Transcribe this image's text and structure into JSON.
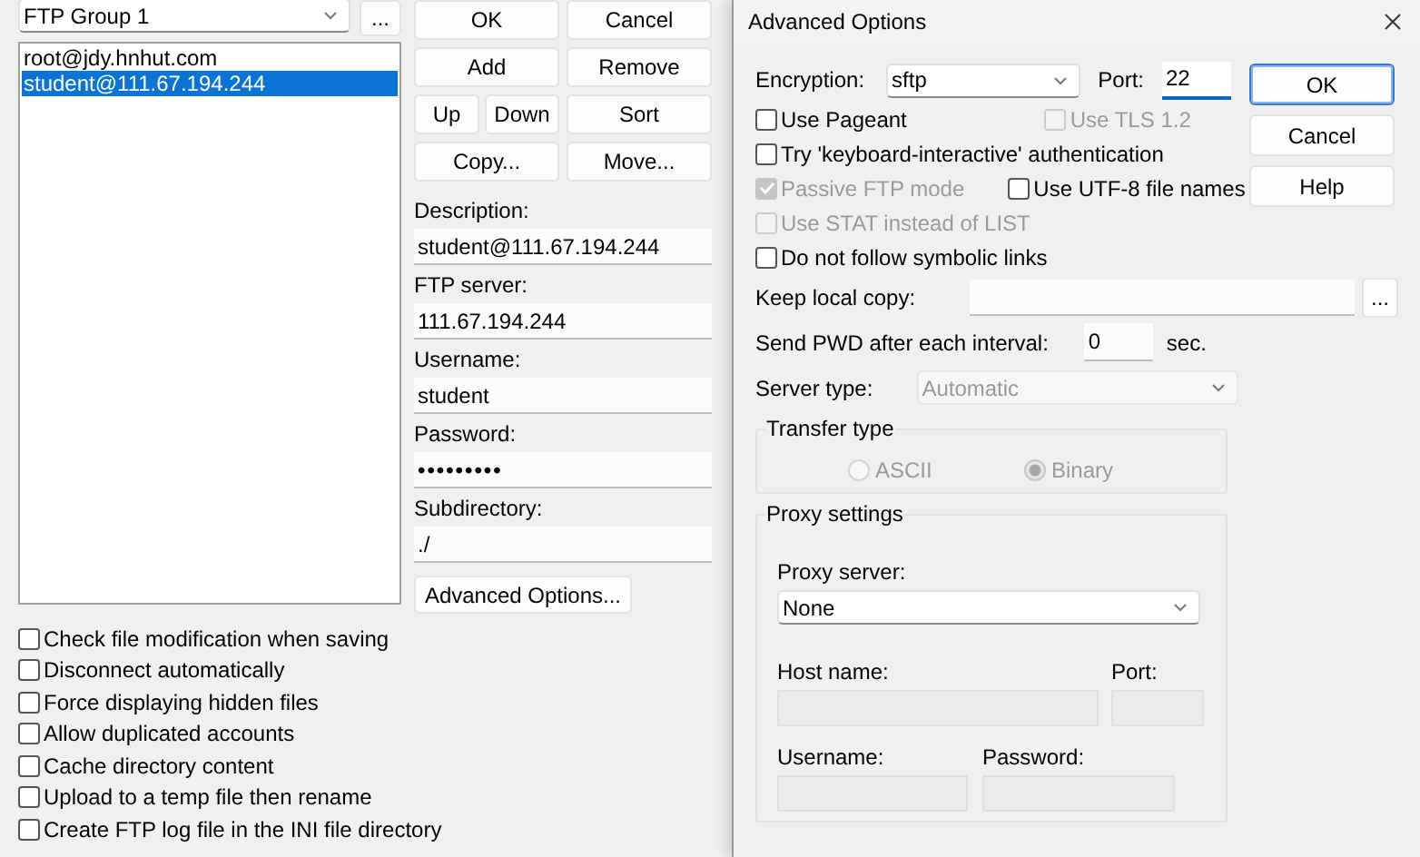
{
  "main": {
    "group": {
      "value": "FTP Group 1"
    },
    "group_more_button": "...",
    "accounts": [
      {
        "label": "root@jdy.hnhut.com",
        "selected": false
      },
      {
        "label": "student@111.67.194.244",
        "selected": true
      }
    ],
    "button_rows": [
      [
        "OK",
        "Cancel"
      ],
      [
        "Add",
        "Remove"
      ],
      [
        "Up",
        "Down",
        "Sort"
      ],
      [
        "Copy...",
        "Move..."
      ]
    ],
    "fields": [
      {
        "label": "Description:",
        "value": "student@111.67.194.244"
      },
      {
        "label": "FTP server:",
        "value": "111.67.194.244"
      },
      {
        "label": "Username:",
        "value": "student"
      },
      {
        "label": "Password:",
        "value": "•••••••••",
        "kind": "password"
      },
      {
        "label": "Subdirectory:",
        "value": "./"
      }
    ],
    "advanced_button": "Advanced Options...",
    "options": [
      {
        "label": "Check file modification when saving",
        "checked": false
      },
      {
        "label": "Disconnect automatically",
        "checked": false
      },
      {
        "label": "Force displaying hidden files",
        "checked": false
      },
      {
        "label": "Allow duplicated accounts",
        "checked": false
      },
      {
        "label": "Cache directory content",
        "checked": false
      },
      {
        "label": "Upload to a temp file then rename",
        "checked": false
      },
      {
        "label": "Create FTP log file in the INI file directory",
        "checked": false
      }
    ]
  },
  "dialog": {
    "title": "Advanced Options",
    "encryption": {
      "label": "Encryption:",
      "value": "sftp"
    },
    "port": {
      "label": "Port:",
      "value": "22",
      "focused": true
    },
    "buttons": [
      {
        "label": "OK",
        "default": true
      },
      {
        "label": "Cancel",
        "default": false
      },
      {
        "label": "Help",
        "default": false
      }
    ],
    "option_rows": [
      [
        {
          "label": "Use Pageant",
          "checked": false,
          "disabled": false
        },
        {
          "label": "Use TLS 1.2",
          "checked": false,
          "disabled": true
        }
      ],
      [
        {
          "label": "Try 'keyboard-interactive' authentication",
          "checked": false,
          "disabled": false
        }
      ],
      [
        {
          "label": "Passive FTP mode",
          "checked": true,
          "disabled": true
        },
        {
          "label": "Use UTF-8 file names",
          "checked": false,
          "disabled": false
        }
      ],
      [
        {
          "label": "Use STAT instead of LIST",
          "checked": false,
          "disabled": true
        }
      ],
      [
        {
          "label": "Do not follow symbolic links",
          "checked": false,
          "disabled": false
        }
      ]
    ],
    "keep_local_copy": {
      "label": "Keep local copy:",
      "browse_button": "..."
    },
    "send_pwd": {
      "label": "Send PWD after each interval:",
      "value": "0",
      "unit": "sec."
    },
    "server_type": {
      "label": "Server type:",
      "value": "Automatic",
      "disabled": true
    },
    "transfer_type": {
      "title": "Transfer type",
      "options": [
        {
          "label": "ASCII",
          "selected": false,
          "disabled": true
        },
        {
          "label": "Binary",
          "selected": true,
          "disabled": true
        }
      ]
    },
    "proxy": {
      "title": "Proxy settings",
      "server": {
        "label": "Proxy server:",
        "value": "None"
      },
      "host": {
        "label": "Host name:",
        "disabled": true
      },
      "port": {
        "label": "Port:",
        "disabled": true
      },
      "username": {
        "label": "Username:",
        "disabled": true
      },
      "password": {
        "label": "Password:",
        "disabled": true
      }
    }
  }
}
